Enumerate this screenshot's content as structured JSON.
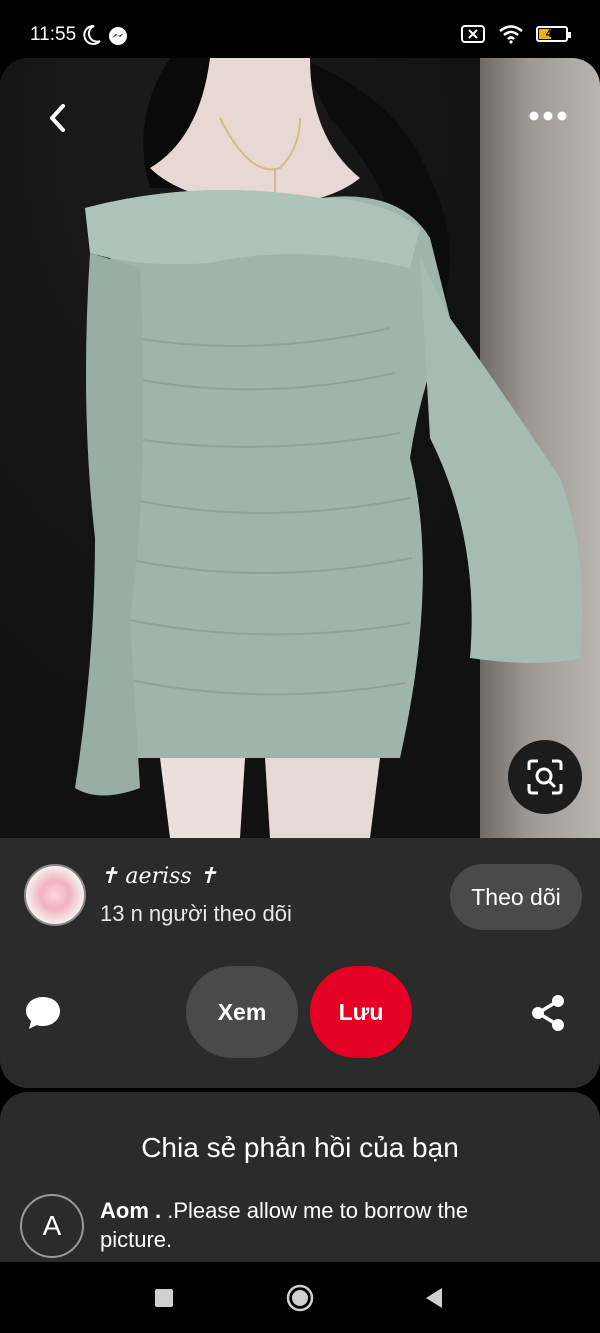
{
  "status_bar": {
    "time": "11:55",
    "battery_level": "43",
    "icons": [
      "moon-icon",
      "messenger-icon",
      "sim-off-icon",
      "wifi-icon",
      "battery-icon"
    ]
  },
  "pin": {
    "icons": [
      "back-arrow-icon",
      "more-dots-icon",
      "visual-search-icon"
    ]
  },
  "creator": {
    "name": "✝ aeriss ✝",
    "followers": "13 n người theo dõi",
    "follow_label": "Theo dõi"
  },
  "actions": {
    "view_label": "Xem",
    "save_label": "Lưu",
    "save_color": "#e60023",
    "icons": [
      "comment-icon",
      "share-icon"
    ]
  },
  "feedback": {
    "title": "Chia sẻ phản hồi của bạn",
    "comment": {
      "avatar_letter": "A",
      "author": "Aom .",
      "text": " .Please allow me to borrow the picture."
    }
  },
  "nav": {
    "icons": [
      "recents-square-icon",
      "home-circle-icon",
      "back-triangle-icon"
    ]
  }
}
